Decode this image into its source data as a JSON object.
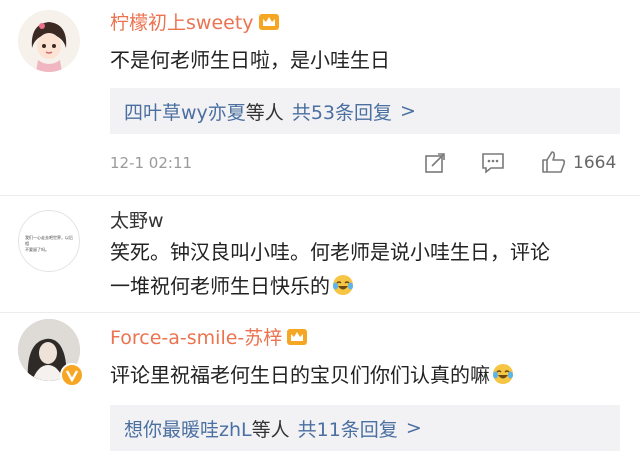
{
  "comments": [
    {
      "username": "柠檬初上sweety",
      "text": "不是何老师生日啦，是小哇生日",
      "reply_prefix": "四叶草wy亦夏",
      "reply_mid": "等人",
      "reply_count": "共53条回复",
      "reply_arrow": ">",
      "timestamp": "12-1 02:11",
      "likes": "1664",
      "avatar_icon": "cartoon-girl-avatar",
      "badge_icon": "crown-badge-icon"
    },
    {
      "username": "太野w",
      "text_line1": "笑死。钟汉良叫小哇。何老师是说小哇生日，评论",
      "text_line2": "一堆祝何老师生日快乐的",
      "avatar_icon": "text-image-avatar",
      "avatar_text_line1": "我们一心走去吧世界，以后相",
      "avatar_text_line2": "不要留了吗。"
    },
    {
      "username": "Force-a-smile-苏梓",
      "text": "评论里祝福老何生日的宝贝们你们认真的嘛",
      "reply_prefix": "想你最暖哇zhL",
      "reply_mid": "等人",
      "reply_count": "共11条回复",
      "reply_arrow": ">",
      "avatar_icon": "photo-avatar",
      "badge_icon": "crown-badge-icon"
    }
  ],
  "colors": {
    "username_orange": "#eb7350",
    "link_blue": "#4a6fa0",
    "reply_bg": "#f2f2f5",
    "crown": "#f5a623"
  }
}
